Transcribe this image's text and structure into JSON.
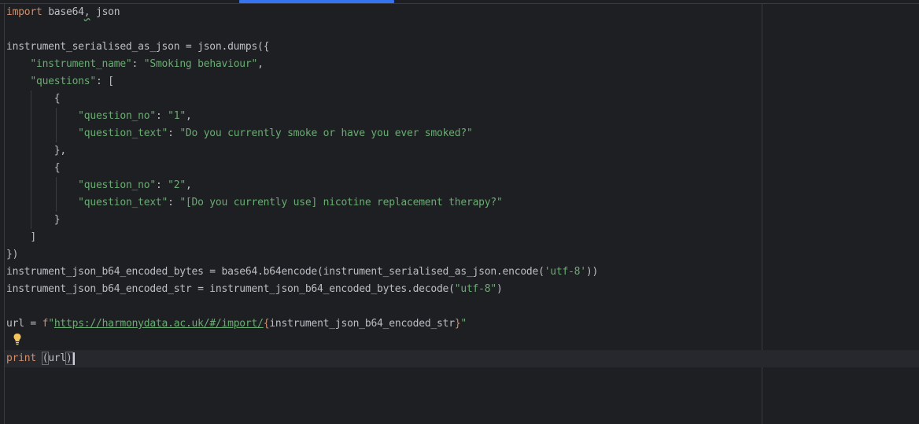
{
  "editor": {
    "lines": [
      {
        "parts": [
          [
            "kw",
            "import"
          ],
          [
            "plain",
            " base64"
          ],
          [
            "wavy",
            ","
          ],
          [
            "plain",
            " json"
          ]
        ]
      },
      {
        "parts": []
      },
      {
        "parts": [
          [
            "plain",
            "instrument_serialised_as_json = json.dumps({"
          ]
        ]
      },
      {
        "parts": [
          [
            "plain",
            "    "
          ],
          [
            "key",
            "\"instrument_name\""
          ],
          [
            "plain",
            ": "
          ],
          [
            "str",
            "\"Smoking behaviour\""
          ],
          [
            "plain",
            ","
          ]
        ]
      },
      {
        "parts": [
          [
            "plain",
            "    "
          ],
          [
            "key",
            "\"questions\""
          ],
          [
            "plain",
            ": ["
          ]
        ]
      },
      {
        "parts": [
          [
            "plain",
            "        {"
          ]
        ]
      },
      {
        "parts": [
          [
            "plain",
            "            "
          ],
          [
            "key",
            "\"question_no\""
          ],
          [
            "plain",
            ": "
          ],
          [
            "str",
            "\"1\""
          ],
          [
            "plain",
            ","
          ]
        ]
      },
      {
        "parts": [
          [
            "plain",
            "            "
          ],
          [
            "key",
            "\"question_text\""
          ],
          [
            "plain",
            ": "
          ],
          [
            "str",
            "\"Do you currently smoke or have you ever smoked?\""
          ]
        ]
      },
      {
        "parts": [
          [
            "plain",
            "        },"
          ]
        ]
      },
      {
        "parts": [
          [
            "plain",
            "        {"
          ]
        ]
      },
      {
        "parts": [
          [
            "plain",
            "            "
          ],
          [
            "key",
            "\"question_no\""
          ],
          [
            "plain",
            ": "
          ],
          [
            "str",
            "\"2\""
          ],
          [
            "plain",
            ","
          ]
        ]
      },
      {
        "parts": [
          [
            "plain",
            "            "
          ],
          [
            "key",
            "\"question_text\""
          ],
          [
            "plain",
            ": "
          ],
          [
            "str",
            "\"[Do you currently use] nicotine replacement therapy?\""
          ]
        ]
      },
      {
        "parts": [
          [
            "plain",
            "        }"
          ]
        ]
      },
      {
        "parts": [
          [
            "plain",
            "    ]"
          ]
        ]
      },
      {
        "parts": [
          [
            "plain",
            "})"
          ]
        ]
      },
      {
        "parts": [
          [
            "plain",
            "instrument_json_b64_encoded_bytes = base64.b64encode(instrument_serialised_as_json.encode("
          ],
          [
            "str",
            "'utf-8'"
          ],
          [
            "plain",
            "))"
          ]
        ]
      },
      {
        "parts": [
          [
            "plain",
            "instrument_json_b64_encoded_str = instrument_json_b64_encoded_bytes.decode("
          ],
          [
            "str",
            "\"utf-8\""
          ],
          [
            "plain",
            ")"
          ]
        ]
      },
      {
        "parts": []
      },
      {
        "parts": [
          [
            "plain",
            "url = "
          ],
          [
            "fprefix",
            "f"
          ],
          [
            "str",
            "\""
          ],
          [
            "url",
            "https://harmonydata.ac.uk/#/import/"
          ],
          [
            "brace",
            "{"
          ],
          [
            "plain",
            "instrument_json_b64_encoded_str"
          ],
          [
            "brace",
            "}"
          ],
          [
            "str",
            "\""
          ]
        ]
      },
      {
        "parts": []
      },
      {
        "parts": [
          [
            "kw",
            "print"
          ],
          [
            "plain",
            " "
          ],
          [
            "paren",
            "("
          ],
          [
            "plain",
            "url"
          ],
          [
            "paren",
            ")"
          ]
        ],
        "caret": true
      }
    ]
  },
  "colors": {
    "background": "#1e1f22",
    "keyword": "#cf8e6d",
    "string": "#6aab73",
    "text": "#bcbec4",
    "scroll_indicator": "#3574f0"
  },
  "icons": {
    "intention": "lightbulb-icon"
  }
}
